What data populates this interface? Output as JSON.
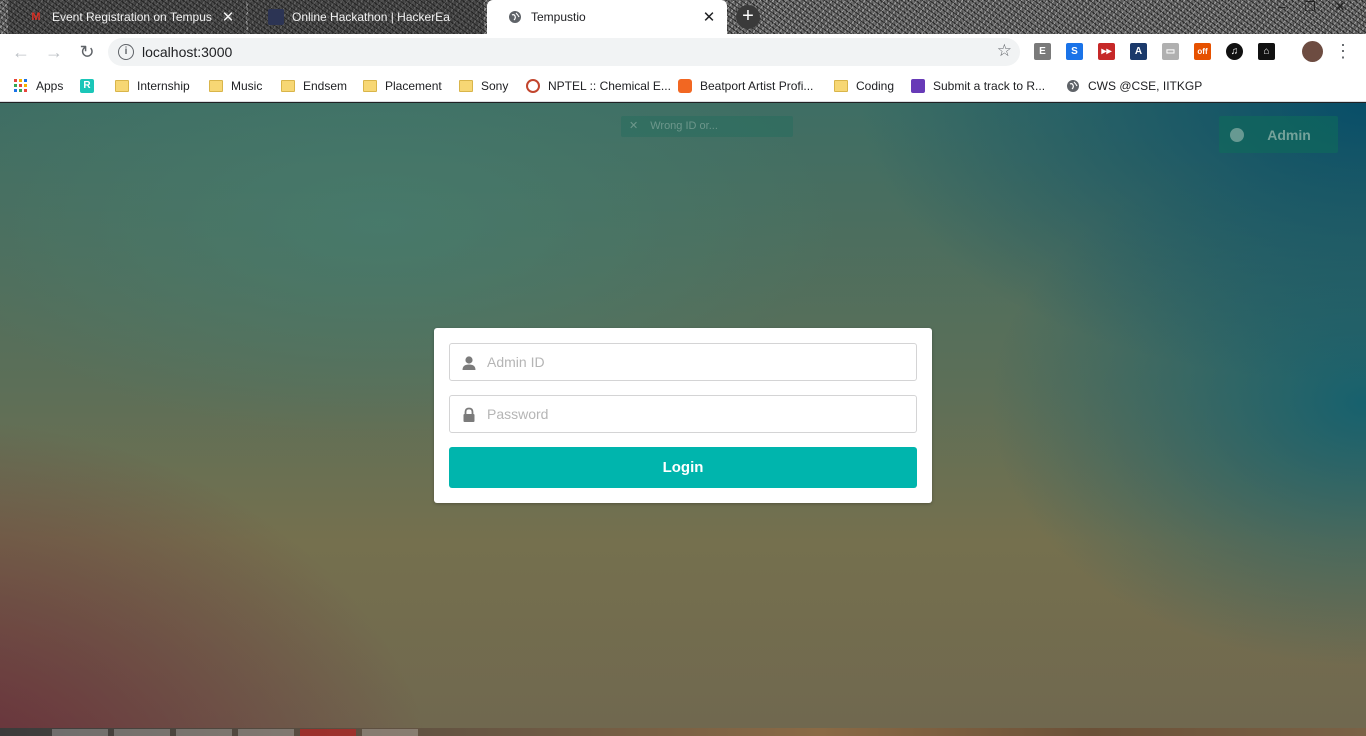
{
  "browser": {
    "tabs": [
      {
        "title": "Event Registration on Tempustio",
        "favicon": "gmail-icon",
        "active": false
      },
      {
        "title": "Online Hackathon | HackerEarth",
        "favicon": "hackerearth-icon",
        "active": false
      },
      {
        "title": "Tempustio",
        "favicon": "globe-icon",
        "active": true
      }
    ],
    "tab_close": "✕",
    "new_tab": "+",
    "url": "localhost:3000",
    "extensions": [
      {
        "name": "evernote-icon",
        "label": "E",
        "color": "#7a7a7a"
      },
      {
        "name": "s-extension-icon",
        "label": "S",
        "color": "#1a73e8"
      },
      {
        "name": "fast-forward-icon",
        "label": "▸▸",
        "color": "#c62828"
      },
      {
        "name": "bookmark-extension-icon",
        "label": "A",
        "color": "#1b3a6b"
      },
      {
        "name": "briefcase-icon",
        "label": "▭",
        "color": "#b0b0b0"
      },
      {
        "name": "off-badge-icon",
        "label": "off",
        "color": "#e65100"
      },
      {
        "name": "itunes-icon",
        "label": "♫",
        "color": "#111111"
      },
      {
        "name": "hanger-icon",
        "label": "⌂",
        "color": "#111111"
      }
    ]
  },
  "bookmarks": [
    {
      "label": "Apps",
      "icon": "apps-grid-icon"
    },
    {
      "label": "",
      "icon": "r-extension-icon"
    },
    {
      "label": "Internship",
      "icon": "folder-icon"
    },
    {
      "label": "Music",
      "icon": "folder-icon"
    },
    {
      "label": "Endsem",
      "icon": "folder-icon"
    },
    {
      "label": "Placement",
      "icon": "folder-icon"
    },
    {
      "label": "Sony",
      "icon": "folder-icon"
    },
    {
      "label": "NPTEL :: Chemical E...",
      "icon": "nptel-icon"
    },
    {
      "label": "Beatport Artist Profi...",
      "icon": "beatport-icon"
    },
    {
      "label": "Coding",
      "icon": "folder-icon"
    },
    {
      "label": "Submit a track to R...",
      "icon": "form-icon"
    },
    {
      "label": "CWS @CSE, IITKGP",
      "icon": "globe-icon"
    }
  ],
  "page": {
    "notification": "Wrong ID or...",
    "admin_button": "Admin",
    "login": {
      "admin_id_placeholder": "Admin ID",
      "password_placeholder": "Password",
      "login_label": "Login"
    }
  },
  "colors": {
    "accent": "#00b5ad"
  }
}
